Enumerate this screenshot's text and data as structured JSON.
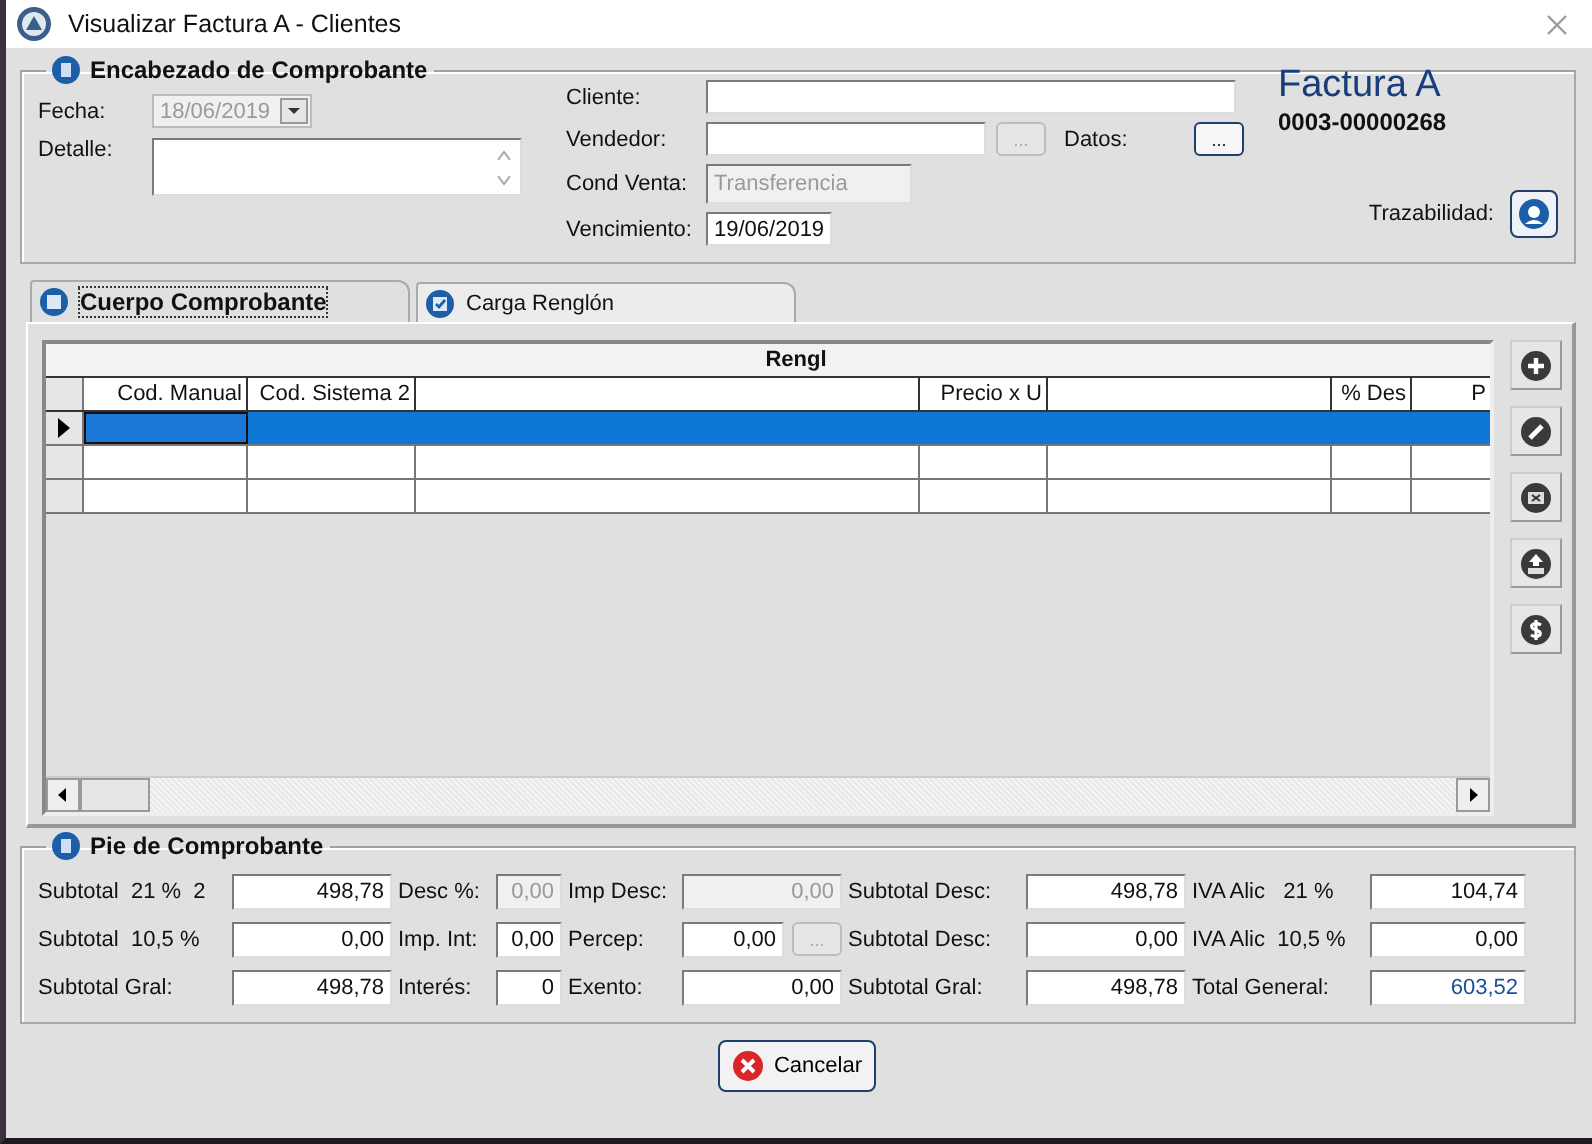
{
  "window": {
    "title": "Visualizar Factura A - Clientes"
  },
  "header": {
    "title": "Encabezado de Comprobante",
    "fecha": {
      "label": "Fecha:",
      "value": "18/06/2019",
      "disabled": true
    },
    "detalle": {
      "label": "Detalle:"
    },
    "cliente": {
      "label": "Cliente:"
    },
    "vendedor": {
      "label": "Vendedor:",
      "button": {
        "label": "...",
        "disabled": true
      }
    },
    "datos": {
      "label": "Datos:",
      "button": {
        "label": "...",
        "disabled": false
      }
    },
    "cond_venta": {
      "label": "Cond Venta:",
      "value": "Transferencia",
      "disabled": true
    },
    "vencimiento": {
      "label": "Vencimiento:",
      "value": "19/06/2019",
      "disabled": false
    },
    "document": {
      "type": "Factura A",
      "number": "0003-00000268"
    },
    "trazabilidad": {
      "label": "Trazabilidad:"
    }
  },
  "tabs": [
    {
      "label": "Cuerpo Comprobante",
      "selected": true
    },
    {
      "label": "Carga Renglón",
      "selected": false
    }
  ],
  "grid": {
    "title": "Rengl",
    "columns": [
      "Cod. Manual",
      "Cod. Sistema 2",
      "Precio x U",
      "% Des",
      "P"
    ],
    "rows": [
      {
        "selected": true
      },
      {
        "selected": false
      },
      {
        "selected": false
      }
    ]
  },
  "footer": {
    "title": "Pie de Comprobante",
    "rows": [
      [
        {
          "label": "Subtotal  21 %  2",
          "value": "498,78",
          "disabled": false,
          "kind": "plain"
        },
        {
          "label": "Desc %:",
          "value": "0,00",
          "disabled": true,
          "kind": "plain"
        },
        {
          "label": "Imp Desc:",
          "value": "0,00",
          "disabled": true,
          "kind": "plain"
        },
        {
          "label": "Subtotal Desc:",
          "value": "498,78",
          "disabled": false,
          "kind": "plain"
        },
        {
          "label": "IVA Alic   21 %",
          "value": "104,74",
          "disabled": false,
          "kind": "plain"
        }
      ],
      [
        {
          "label": "Subtotal  10,5 %",
          "value": "0,00",
          "disabled": false,
          "kind": "plain"
        },
        {
          "label": "Imp. Int:",
          "value": "0,00",
          "disabled": false,
          "kind": "plain"
        },
        {
          "label": "Percep:",
          "value": "0,00",
          "disabled": false,
          "kind": "plain",
          "button": {
            "label": "...",
            "disabled": true
          }
        },
        {
          "label": "Subtotal Desc:",
          "value": "0,00",
          "disabled": false,
          "kind": "plain"
        },
        {
          "label": "IVA Alic  10,5 %",
          "value": "0,00",
          "disabled": false,
          "kind": "plain"
        }
      ],
      [
        {
          "label": "Subtotal Gral:",
          "value": "498,78",
          "disabled": false,
          "kind": "plain"
        },
        {
          "label": "Interés:",
          "value": "0",
          "disabled": false,
          "kind": "plain"
        },
        {
          "label": "Exento:",
          "value": "0,00",
          "disabled": false,
          "kind": "plain"
        },
        {
          "label": "Subtotal Gral:",
          "value": "498,78",
          "disabled": false,
          "kind": "plain"
        },
        {
          "label": "Total General:",
          "value": "603,52",
          "disabled": false,
          "kind": "total"
        }
      ]
    ]
  },
  "buttons": [
    {
      "label": "Cancelar",
      "kind": "cancel"
    }
  ]
}
